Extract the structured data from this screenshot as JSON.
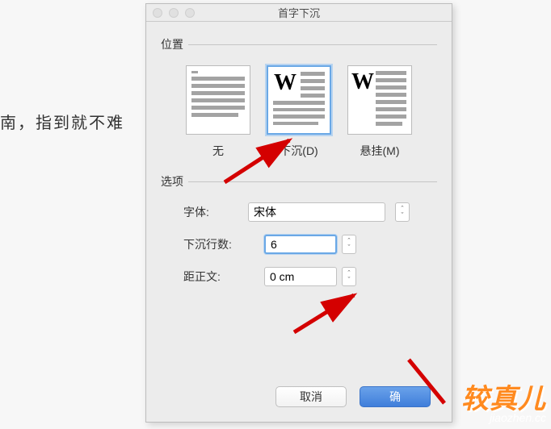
{
  "background_text": "南，指到就不难",
  "dialog": {
    "title": "首字下沉",
    "position_label": "位置",
    "position_options": {
      "none": "无",
      "dropped": "下沉(D)",
      "margin": "悬挂(M)"
    },
    "options_label": "选项",
    "font_label": "字体:",
    "font_value": "宋体",
    "lines_label": "下沉行数:",
    "lines_value": "6",
    "distance_label": "距正文:",
    "distance_value": "0 cm",
    "cancel": "取消",
    "ok": "确"
  },
  "watermark": {
    "big": "较真儿",
    "small": "jiaozhen.cc"
  }
}
